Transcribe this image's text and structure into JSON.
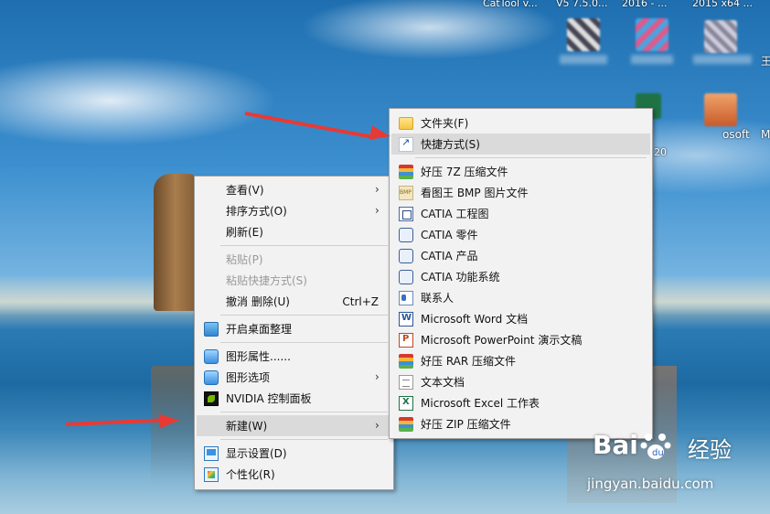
{
  "desktop": {
    "top_labels": [
      "CatTool v...",
      "V5 7.5.0...",
      "2016 - ...",
      "2015 x64 ..."
    ],
    "icon_labels": [
      "osoft",
      "20"
    ],
    "edge_labels": [
      "王",
      "M"
    ]
  },
  "context_menu": {
    "items": [
      {
        "label": "查看(V)",
        "has_submenu": true
      },
      {
        "label": "排序方式(O)",
        "has_submenu": true
      },
      {
        "label": "刷新(E)"
      },
      {
        "label": "粘贴(P)",
        "disabled": true
      },
      {
        "label": "粘贴快捷方式(S)",
        "disabled": true
      },
      {
        "label": "撤消 删除(U)",
        "shortcut": "Ctrl+Z"
      },
      {
        "label": "开启桌面整理",
        "icon": "desktop-organize-icon"
      },
      {
        "label": "图形属性......",
        "icon": "graphics-icon"
      },
      {
        "label": "图形选项",
        "icon": "graphics-icon",
        "has_submenu": true
      },
      {
        "label": "NVIDIA 控制面板",
        "icon": "nvidia-icon"
      },
      {
        "label": "新建(W)",
        "has_submenu": true,
        "highlighted": true
      },
      {
        "label": "显示设置(D)",
        "icon": "display-icon"
      },
      {
        "label": "个性化(R)",
        "icon": "personalize-icon"
      }
    ]
  },
  "new_submenu": {
    "items": [
      {
        "label": "文件夹(F)",
        "icon": "folder-icon"
      },
      {
        "label": "快捷方式(S)",
        "icon": "shortcut-icon",
        "highlighted": true
      },
      {
        "label": "好压 7Z 压缩文件",
        "icon": "haozip-icon"
      },
      {
        "label": "看图王 BMP 图片文件",
        "icon": "bmp-icon"
      },
      {
        "label": "CATIA 工程图",
        "icon": "catia-drawing-icon"
      },
      {
        "label": "CATIA 零件",
        "icon": "catia-part-icon"
      },
      {
        "label": "CATIA 产品",
        "icon": "catia-product-icon"
      },
      {
        "label": "CATIA 功能系统",
        "icon": "catia-system-icon"
      },
      {
        "label": "联系人",
        "icon": "contact-icon"
      },
      {
        "label": "Microsoft Word 文档",
        "icon": "word-icon"
      },
      {
        "label": "Microsoft PowerPoint 演示文稿",
        "icon": "powerpoint-icon"
      },
      {
        "label": "好压 RAR 压缩文件",
        "icon": "haozip-icon"
      },
      {
        "label": "文本文档",
        "icon": "text-file-icon"
      },
      {
        "label": "Microsoft Excel 工作表",
        "icon": "excel-icon"
      },
      {
        "label": "好压 ZIP 压缩文件",
        "icon": "haozip-icon"
      }
    ]
  },
  "watermark": {
    "brand_left": "Bai",
    "brand_right": "经验",
    "url": "jingyan.baidu.com"
  },
  "colors": {
    "menu_bg": "#f2f2f2",
    "highlight": "#dadada",
    "annotation_arrow": "#e83a34"
  }
}
